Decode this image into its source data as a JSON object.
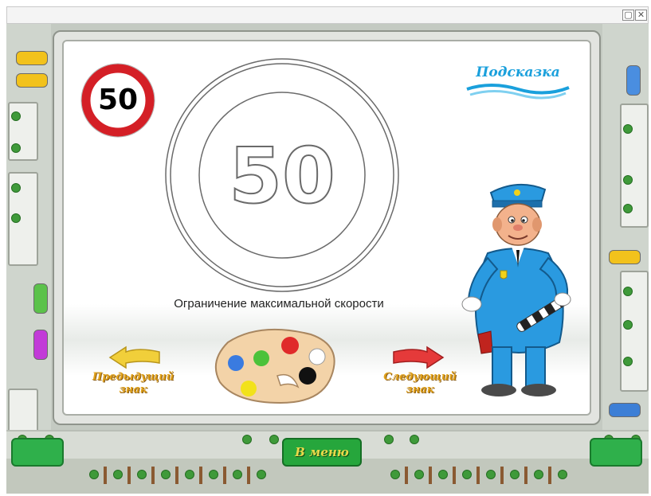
{
  "window": {
    "minimize_glyph": "▢",
    "close_glyph": "✕"
  },
  "sign": {
    "small_value": "50",
    "large_value": "50",
    "caption": "Ограничение максимальной скорости"
  },
  "hint": {
    "label": "Подсказка"
  },
  "navigation": {
    "prev_label_line1": "Предыдущий",
    "prev_label_line2": "знак",
    "next_label_line1": "Следующий",
    "next_label_line2": "знак",
    "menu_label": "В меню"
  },
  "palette": {
    "paint_colors": [
      "#3a7be0",
      "#4cc23a",
      "#e02a2a",
      "#111111",
      "#ffffff",
      "#f2e21a"
    ]
  },
  "colors": {
    "sign_red": "#d41f26",
    "arrow_prev": "#f1cf3a",
    "arrow_next": "#e53a3a",
    "officer_uniform": "#2a9ae0",
    "accent_green": "#26a63c"
  },
  "icons": {
    "small_sign": "speed-limit-sign-icon",
    "big_sign": "speed-limit-sign-outline",
    "prev": "arrow-left-icon",
    "next": "arrow-right-icon",
    "palette": "paint-palette-icon",
    "officer": "traffic-officer-character"
  }
}
